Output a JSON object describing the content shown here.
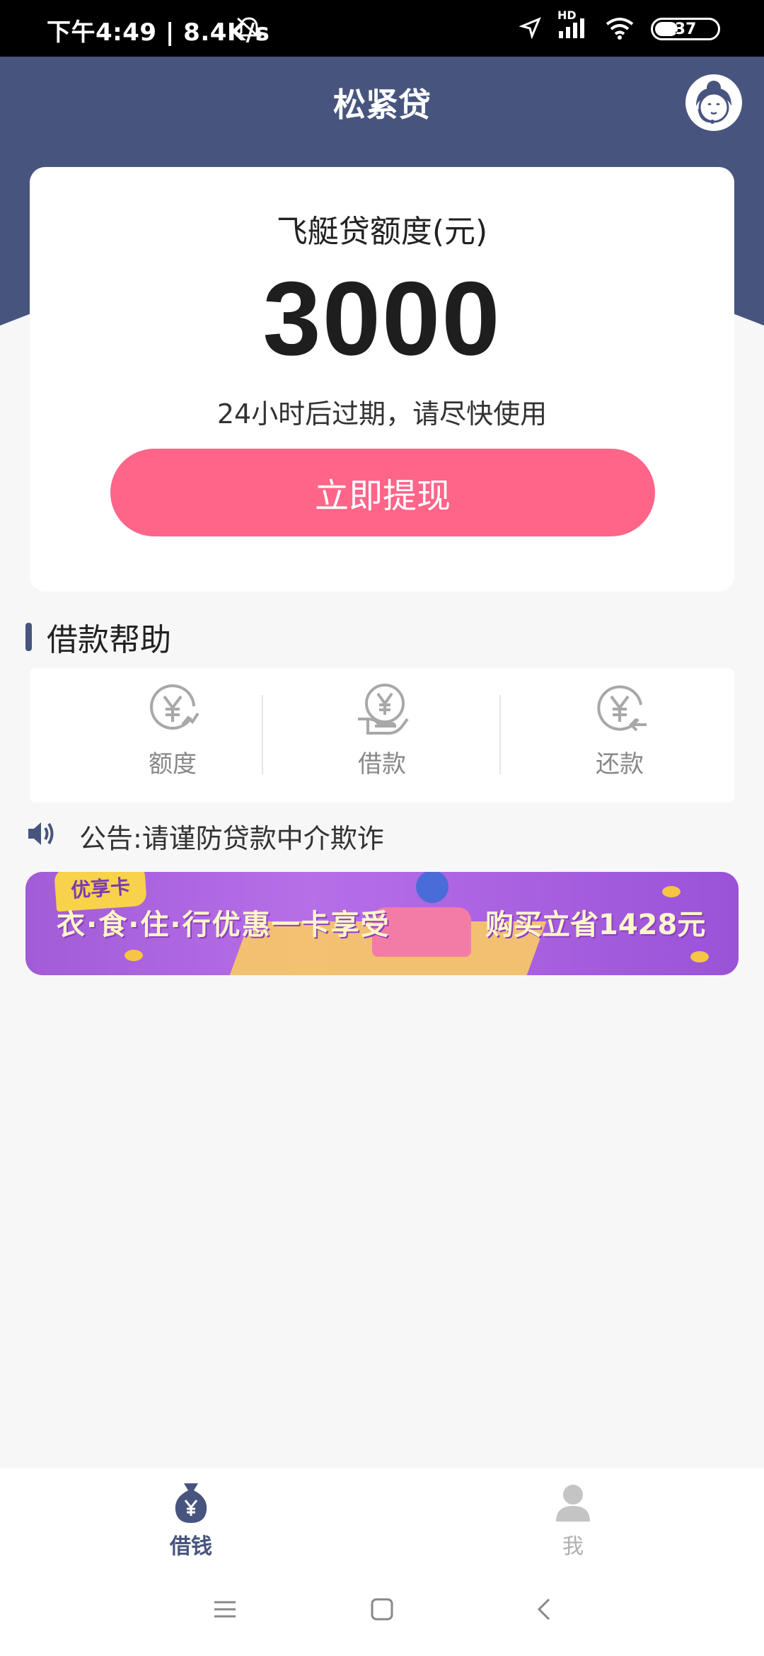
{
  "status_bar": {
    "time_speed": "下午4:49 | 8.4K/s",
    "network": "HD",
    "battery": "37",
    "battery_level": 0.37
  },
  "header": {
    "title": "松紧贷",
    "service_icon": "customer-service-icon"
  },
  "card": {
    "label": "飞艇贷额度(元)",
    "amount": "3000",
    "expire_text": "24小时后过期，请尽快使用",
    "withdraw_button": "立即提现"
  },
  "help": {
    "title": "借款帮助",
    "items": [
      {
        "label": "额度",
        "icon": "yen-quota-icon"
      },
      {
        "label": "借款",
        "icon": "yen-hand-icon"
      },
      {
        "label": "还款",
        "icon": "yen-return-icon"
      }
    ]
  },
  "notice": {
    "text": "公告:请谨防贷款中介欺诈",
    "icon": "speaker-icon"
  },
  "banner": {
    "tag": "优享卡",
    "left_text": "衣·食·住·行优惠一卡享受",
    "right_text": "购买立省1428元"
  },
  "bottom_nav": [
    {
      "label": "借钱",
      "icon": "money-bag-icon",
      "active": true
    },
    {
      "label": "我",
      "icon": "user-icon",
      "active": false
    }
  ],
  "colors": {
    "header": "#47557e",
    "accent": "#fe6589"
  }
}
